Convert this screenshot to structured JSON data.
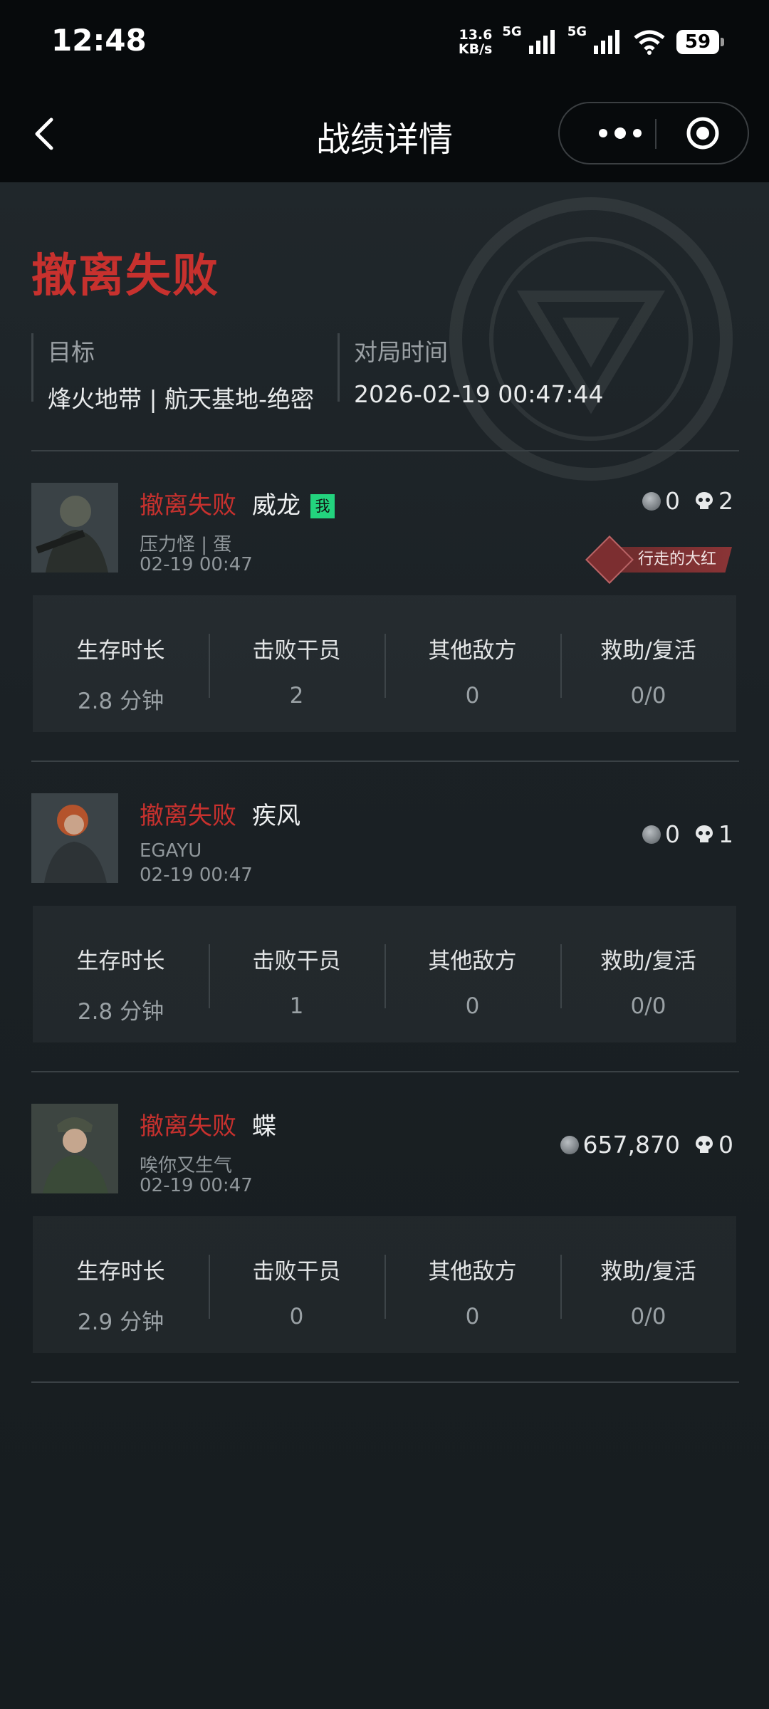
{
  "status_bar": {
    "time": "12:48",
    "speed_value": "13.6",
    "speed_unit": "KB/s",
    "net1": "5G",
    "net2": "5G",
    "battery": "59"
  },
  "nav": {
    "title": "战绩详情"
  },
  "summary": {
    "result": "撤离失败",
    "target_label": "目标",
    "target_value": "烽火地带 | 航天基地-绝密",
    "time_label": "对局时间",
    "time_value": "2026-02-19 00:47:44"
  },
  "stat_labels": {
    "survival": "生存时长",
    "kills": "击败干员",
    "others": "其他敌方",
    "assist": "救助/复活"
  },
  "players": [
    {
      "status": "撤离失败",
      "name": "威龙",
      "me_badge": "我",
      "subtitle": "压力怪 | 蛋",
      "time": "02-19 00:47",
      "coins": "0",
      "kills_count": "2",
      "rank": "行走的大红",
      "survival": "2.8 分钟",
      "kills": "2",
      "others": "0",
      "assist": "0/0"
    },
    {
      "status": "撤离失败",
      "name": "疾风",
      "subtitle": "EGAYU",
      "time": "02-19 00:47",
      "coins": "0",
      "kills_count": "1",
      "survival": "2.8 分钟",
      "kills": "1",
      "others": "0",
      "assist": "0/0"
    },
    {
      "status": "撤离失败",
      "name": "蝶",
      "subtitle": "唉你又生气",
      "time": "02-19 00:47",
      "coins": "657,870",
      "kills_count": "0",
      "survival": "2.9 分钟",
      "kills": "0",
      "others": "0",
      "assist": "0/0"
    }
  ],
  "colors": {
    "fail_red": "#c7312e",
    "me_badge_green": "#23d37e",
    "background": "#1b2125"
  }
}
